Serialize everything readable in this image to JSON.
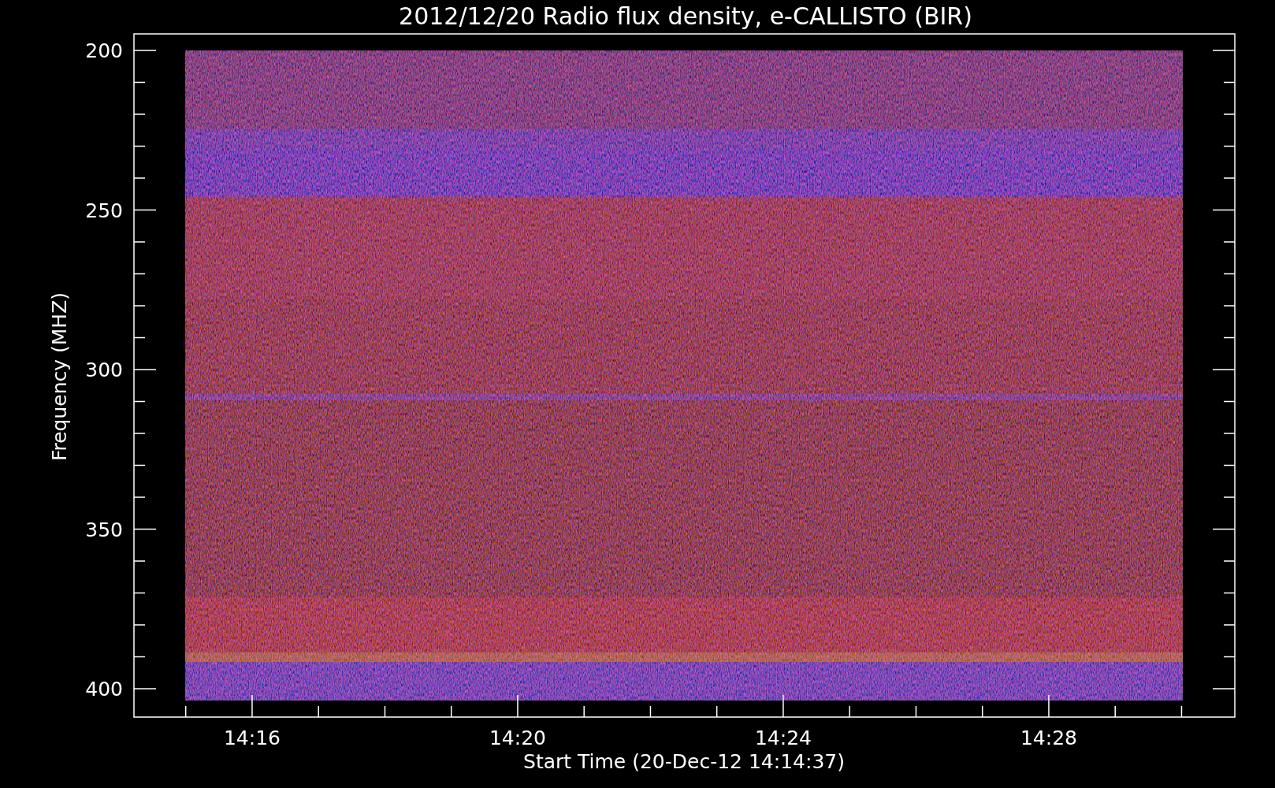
{
  "title": "2012/12/20  Radio flux density, e-CALLISTO (BIR)",
  "y_axis": {
    "label": "Frequency (MHZ)",
    "tick_labels": [
      "200",
      "250",
      "300",
      "350",
      "400"
    ]
  },
  "x_axis": {
    "label": "Start Time (20-Dec-12 14:14:37)",
    "tick_labels": [
      "14:16",
      "14:20",
      "14:24",
      "14:28"
    ]
  }
}
